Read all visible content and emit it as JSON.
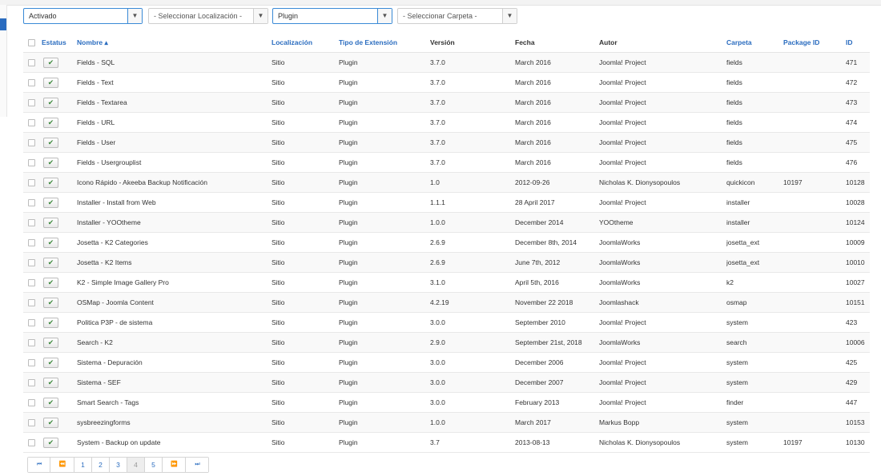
{
  "filters": [
    {
      "value": "Activado",
      "active": true
    },
    {
      "value": "- Seleccionar Localización -",
      "active": false
    },
    {
      "value": "Plugin",
      "active": true
    },
    {
      "value": "- Seleccionar Carpeta -",
      "active": false
    }
  ],
  "columns": {
    "estatus": "Estatus",
    "nombre": "Nombre",
    "localizacion": "Localización",
    "tipo": "Tipo de Extensión",
    "version": "Versión",
    "fecha": "Fecha",
    "autor": "Autor",
    "carpeta": "Carpeta",
    "package_id": "Package ID",
    "id": "ID"
  },
  "rows": [
    {
      "name": "Fields - SQL",
      "loc": "Sitio",
      "type": "Plugin",
      "version": "3.7.0",
      "date": "March 2016",
      "author": "Joomla! Project",
      "folder": "fields",
      "package": "",
      "id": "471"
    },
    {
      "name": "Fields - Text",
      "loc": "Sitio",
      "type": "Plugin",
      "version": "3.7.0",
      "date": "March 2016",
      "author": "Joomla! Project",
      "folder": "fields",
      "package": "",
      "id": "472"
    },
    {
      "name": "Fields - Textarea",
      "loc": "Sitio",
      "type": "Plugin",
      "version": "3.7.0",
      "date": "March 2016",
      "author": "Joomla! Project",
      "folder": "fields",
      "package": "",
      "id": "473"
    },
    {
      "name": "Fields - URL",
      "loc": "Sitio",
      "type": "Plugin",
      "version": "3.7.0",
      "date": "March 2016",
      "author": "Joomla! Project",
      "folder": "fields",
      "package": "",
      "id": "474"
    },
    {
      "name": "Fields - User",
      "loc": "Sitio",
      "type": "Plugin",
      "version": "3.7.0",
      "date": "March 2016",
      "author": "Joomla! Project",
      "folder": "fields",
      "package": "",
      "id": "475"
    },
    {
      "name": "Fields - Usergrouplist",
      "loc": "Sitio",
      "type": "Plugin",
      "version": "3.7.0",
      "date": "March 2016",
      "author": "Joomla! Project",
      "folder": "fields",
      "package": "",
      "id": "476"
    },
    {
      "name": "Icono Rápido - Akeeba Backup Notificación",
      "loc": "Sitio",
      "type": "Plugin",
      "version": "1.0",
      "date": "2012-09-26",
      "author": "Nicholas K. Dionysopoulos",
      "folder": "quickicon",
      "package": "10197",
      "id": "10128"
    },
    {
      "name": "Installer - Install from Web",
      "loc": "Sitio",
      "type": "Plugin",
      "version": "1.1.1",
      "date": "28 April 2017",
      "author": "Joomla! Project",
      "folder": "installer",
      "package": "",
      "id": "10028"
    },
    {
      "name": "Installer - YOOtheme",
      "loc": "Sitio",
      "type": "Plugin",
      "version": "1.0.0",
      "date": "December 2014",
      "author": "YOOtheme",
      "folder": "installer",
      "package": "",
      "id": "10124"
    },
    {
      "name": "Josetta - K2 Categories",
      "loc": "Sitio",
      "type": "Plugin",
      "version": "2.6.9",
      "date": "December 8th, 2014",
      "author": "JoomlaWorks",
      "folder": "josetta_ext",
      "package": "",
      "id": "10009"
    },
    {
      "name": "Josetta - K2 Items",
      "loc": "Sitio",
      "type": "Plugin",
      "version": "2.6.9",
      "date": "June 7th, 2012",
      "author": "JoomlaWorks",
      "folder": "josetta_ext",
      "package": "",
      "id": "10010"
    },
    {
      "name": "K2 - Simple Image Gallery Pro",
      "loc": "Sitio",
      "type": "Plugin",
      "version": "3.1.0",
      "date": "April 5th, 2016",
      "author": "JoomlaWorks",
      "folder": "k2",
      "package": "",
      "id": "10027"
    },
    {
      "name": "OSMap - Joomla Content",
      "loc": "Sitio",
      "type": "Plugin",
      "version": "4.2.19",
      "date": "November 22 2018",
      "author": "Joomlashack",
      "folder": "osmap",
      "package": "",
      "id": "10151"
    },
    {
      "name": "Politica P3P - de sistema",
      "loc": "Sitio",
      "type": "Plugin",
      "version": "3.0.0",
      "date": "September 2010",
      "author": "Joomla! Project",
      "folder": "system",
      "package": "",
      "id": "423"
    },
    {
      "name": "Search - K2",
      "loc": "Sitio",
      "type": "Plugin",
      "version": "2.9.0",
      "date": "September 21st, 2018",
      "author": "JoomlaWorks",
      "folder": "search",
      "package": "",
      "id": "10006"
    },
    {
      "name": "Sistema - Depuración",
      "loc": "Sitio",
      "type": "Plugin",
      "version": "3.0.0",
      "date": "December 2006",
      "author": "Joomla! Project",
      "folder": "system",
      "package": "",
      "id": "425"
    },
    {
      "name": "Sistema - SEF",
      "loc": "Sitio",
      "type": "Plugin",
      "version": "3.0.0",
      "date": "December 2007",
      "author": "Joomla! Project",
      "folder": "system",
      "package": "",
      "id": "429"
    },
    {
      "name": "Smart Search - Tags",
      "loc": "Sitio",
      "type": "Plugin",
      "version": "3.0.0",
      "date": "February 2013",
      "author": "Joomla! Project",
      "folder": "finder",
      "package": "",
      "id": "447"
    },
    {
      "name": "sysbreezingforms",
      "loc": "Sitio",
      "type": "Plugin",
      "version": "1.0.0",
      "date": "March 2017",
      "author": "Markus Bopp",
      "folder": "system",
      "package": "",
      "id": "10153"
    },
    {
      "name": "System - Backup on update",
      "loc": "Sitio",
      "type": "Plugin",
      "version": "3.7",
      "date": "2013-08-13",
      "author": "Nicholas K. Dionysopoulos",
      "folder": "system",
      "package": "10197",
      "id": "10130"
    }
  ],
  "pagination": {
    "items": [
      {
        "label": "⏮",
        "type": "first-icon",
        "current": false
      },
      {
        "label": "⏪",
        "type": "previous-icon",
        "current": false
      },
      {
        "label": "1",
        "type": "page",
        "current": false
      },
      {
        "label": "2",
        "type": "page",
        "current": false
      },
      {
        "label": "3",
        "type": "page",
        "current": false
      },
      {
        "label": "4",
        "type": "page",
        "current": true
      },
      {
        "label": "5",
        "type": "page",
        "current": false
      },
      {
        "label": "⏩",
        "type": "next-icon",
        "current": false
      },
      {
        "label": "⏭",
        "type": "last-icon",
        "current": false
      }
    ]
  },
  "icons": {
    "status_enabled": "check-icon",
    "sort_indicator": "sort-ascending-icon",
    "select_caret": "chevron-down-icon"
  },
  "colors": {
    "link": "#2a6cbf",
    "enabled_check": "#3f8a3f",
    "active_select_border": "#3a8ad6"
  }
}
